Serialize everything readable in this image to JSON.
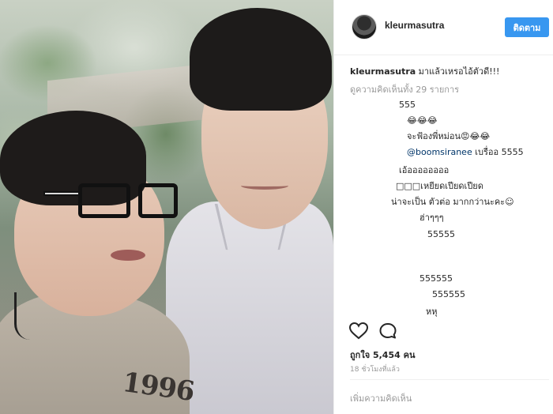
{
  "post": {
    "username": "kleurmasutra",
    "follow_label": "ติดตาม",
    "caption_user": "kleurmasutra",
    "caption_text": "มาแล้วเหรอไอ้ตัวดี!!!",
    "view_all_comments": "ดูความคิดเห็นทั้ง 29 รายการ"
  },
  "comments": [
    {
      "text": "555"
    },
    {
      "text": "😂😂😂"
    },
    {
      "text": "จะฟ้องพี่หม่อน😡😂😂"
    },
    {
      "mention": "@boomsiranee",
      "text": "เบรื่ออ 5555"
    },
    {
      "text": "เอ้ออออออออ"
    },
    {
      "text": "□□□เหยียดเปียดเปียด"
    },
    {
      "text": "น่าจะเป็น ตัวต่อ มากกว่านะคะ☺"
    },
    {
      "text": "ฮ่าๆๆๆ"
    },
    {
      "text": "55555"
    },
    {
      "text": "555555"
    },
    {
      "text": "555555"
    },
    {
      "text": "หหุ"
    }
  ],
  "actions": {
    "likes": "ถูกใจ 5,454 คน",
    "time": "18 ชั่วโมงที่แล้ว",
    "add_comment_placeholder": "เพิ่มความคิดเห็น"
  },
  "photo": {
    "shirt_print": "1996"
  },
  "colors": {
    "accent": "#3897f0",
    "muted": "#999999",
    "mention": "#003569"
  }
}
